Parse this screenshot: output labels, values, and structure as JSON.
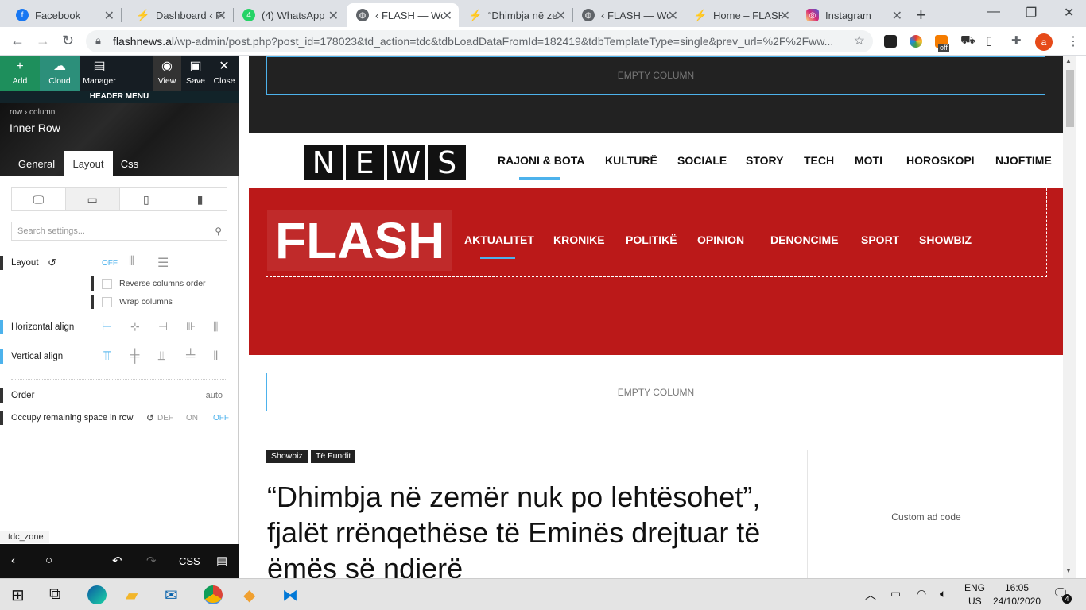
{
  "browser": {
    "tabs": [
      {
        "label": "Facebook",
        "icon": "facebook-icon",
        "color": "#1877f2",
        "active": false
      },
      {
        "label": "Dashboard ‹ Fl",
        "icon": "wordpress-flash-icon",
        "color": "#c62828",
        "active": false
      },
      {
        "label": "(4) WhatsApp",
        "icon": "whatsapp-icon",
        "color": "#25d366",
        "active": false
      },
      {
        "label": "‹ FLASH — Wo",
        "icon": "globe-icon",
        "color": "#5f6368",
        "active": true
      },
      {
        "label": "“Dhimbja në ze",
        "icon": "wordpress-flash-icon",
        "color": "#c62828",
        "active": false
      },
      {
        "label": "‹ FLASH — Wo",
        "icon": "globe-icon",
        "color": "#5f6368",
        "active": false
      },
      {
        "label": "Home – FLASH",
        "icon": "wordpress-flash-icon",
        "color": "#c62828",
        "active": false
      },
      {
        "label": "Instagram",
        "icon": "instagram-icon",
        "color": "#d6249f",
        "active": false
      }
    ],
    "url_host": "flashnews.al",
    "url_rest": "/wp-admin/post.php?post_id=178023&td_action=tdc&tdbLoadDataFromId=182419&tdbTemplateType=single&prev_url=%2F%2Fww...",
    "ext_off_badge": "off",
    "profile_initial": "a"
  },
  "panel": {
    "buttons": {
      "add": "Add",
      "cloud": "Cloud",
      "manager": "Manager",
      "view": "View",
      "save": "Save",
      "close": "Close"
    },
    "header_menu": "HEADER MENU",
    "breadcrumb_row": "row",
    "breadcrumb_column": "column",
    "element_title": "Inner Row",
    "tabs": {
      "general": "General",
      "layout": "Layout",
      "css": "Css"
    },
    "search_placeholder": "Search settings...",
    "layout_label": "Layout",
    "layout_toggle": "OFF",
    "reverse_columns": "Reverse columns order",
    "wrap_columns": "Wrap columns",
    "horizontal_align": "Horizontal align",
    "vertical_align": "Vertical align",
    "order_label": "Order",
    "order_value": "auto",
    "occupy_label": "Occupy remaining space in row",
    "occupy_options": {
      "def": "DEF",
      "on": "ON",
      "off": "OFF"
    },
    "zone_label": "tdc_zone",
    "bottom_css": "CSS"
  },
  "page": {
    "empty_column_top": "EMPTY COLUMN",
    "news_letters": [
      "N",
      "E",
      "W",
      "S"
    ],
    "top_nav": [
      "RAJONI & BOTA",
      "KULTURË",
      "SOCIALE",
      "STORY",
      "TECH",
      "MOTI",
      "HOROSKOPI",
      "NJOFTIME"
    ],
    "flash_logo": "FLASH",
    "red_nav": [
      "AKTUALITET",
      "KRONIKE",
      "POLITIKË",
      "OPINION",
      "DENONCIME",
      "SPORT",
      "SHOWBIZ"
    ],
    "empty_column_mid": "EMPTY COLUMN",
    "tags": [
      "Showbiz",
      "Të Fundit"
    ],
    "headline": "“Dhimbja në zemër nuk po lehtësohet”, fjalët rrënqethëse të Eminës drejtuar të ëmës së ndjerë",
    "ad_text": "Custom ad code",
    "brand_red": "#bb1919",
    "accent_blue": "#4db2ec"
  },
  "taskbar": {
    "lang_top": "ENG",
    "lang_bottom": "US",
    "time": "16:05",
    "date": "24/10/2020",
    "notifications": "4"
  }
}
